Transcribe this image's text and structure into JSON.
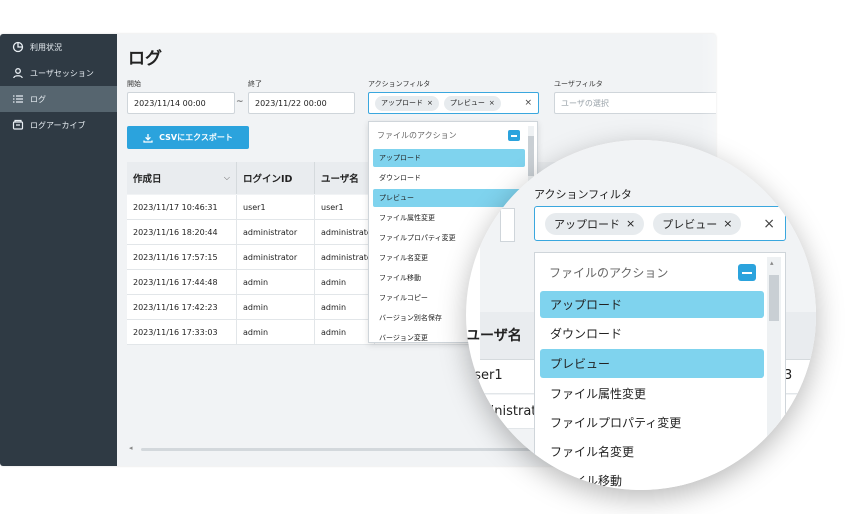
{
  "sidebar": {
    "items": [
      {
        "label": "利用状況",
        "icon": "pie-chart-icon"
      },
      {
        "label": "ユーザセッション",
        "icon": "user-icon"
      },
      {
        "label": "ログ",
        "icon": "list-icon"
      },
      {
        "label": "ログアーカイブ",
        "icon": "archive-icon"
      }
    ],
    "active_index": 2
  },
  "page": {
    "title": "ログ"
  },
  "filters": {
    "start_label": "開始",
    "start_value": "2023/11/14 00:00",
    "end_label": "終了",
    "end_value": "2023/11/22 00:00",
    "range_separator": "~",
    "action_filter_label": "アクションフィルタ",
    "action_chips": [
      "アップロード",
      "プレビュー"
    ],
    "chip_remove": "×",
    "clear_all": "×",
    "user_filter_label": "ユーザフィルタ",
    "user_filter_placeholder": "ユーザの選択"
  },
  "toolbar": {
    "csv_export_label": "CSVにエクスポート"
  },
  "table": {
    "columns": [
      "作成日",
      "ログインID",
      "ユーザ名"
    ],
    "rows": [
      [
        "2023/11/17 10:46:31",
        "user1",
        "user1"
      ],
      [
        "2023/11/16 18:20:44",
        "administrator",
        "administrator"
      ],
      [
        "2023/11/16 17:57:15",
        "administrator",
        "administrator"
      ],
      [
        "2023/11/16 17:44:48",
        "admin",
        "admin"
      ],
      [
        "2023/11/16 17:42:23",
        "admin",
        "admin"
      ],
      [
        "2023/11/16 17:33:03",
        "admin",
        "admin"
      ]
    ]
  },
  "action_dropdown": {
    "group_label": "ファイルのアクション",
    "items": [
      {
        "label": "アップロード",
        "selected": true
      },
      {
        "label": "ダウンロード",
        "selected": false
      },
      {
        "label": "プレビュー",
        "selected": true
      },
      {
        "label": "ファイル属性変更",
        "selected": false
      },
      {
        "label": "ファイルプロパティ変更",
        "selected": false
      },
      {
        "label": "ファイル名変更",
        "selected": false
      },
      {
        "label": "ファイル移動",
        "selected": false
      },
      {
        "label": "ファイルコピー",
        "selected": false
      },
      {
        "label": "バージョン別名保存",
        "selected": false
      },
      {
        "label": "バージョン変更",
        "selected": false
      }
    ]
  },
  "magnifier": {
    "filter_label": "アクションフィルタ",
    "column_label": "ユーザ名",
    "row_fragments": [
      "user1",
      "ministrat"
    ],
    "right_fragment": "3"
  },
  "colors": {
    "sidebar_bg": "#2f3a44",
    "accent": "#2ba3dd",
    "selected_item": "#7fd3ee"
  }
}
